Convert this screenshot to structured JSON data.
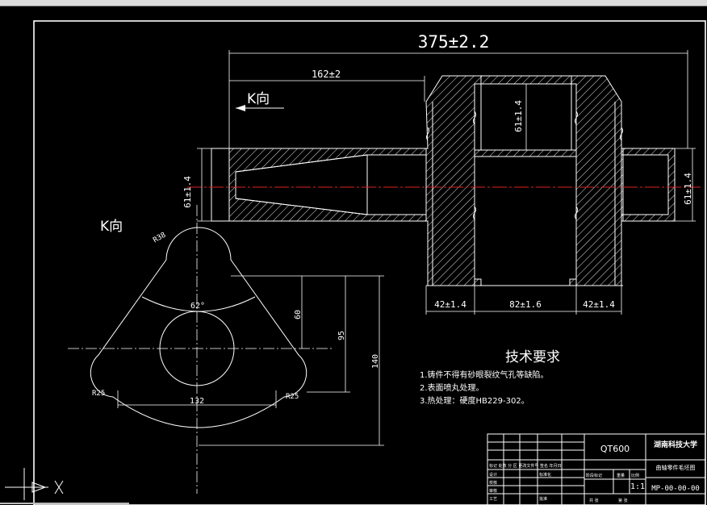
{
  "drawing": {
    "view_label_top": "K向",
    "view_label_side": "K向",
    "dims": {
      "overall_length": "375±2.2",
      "left_length": "162±2",
      "dia_left": "61±1.4",
      "dia_center": "61±1.4",
      "dia_right": "61±1.4",
      "seg1": "42±1.4",
      "seg2": "82±1.6",
      "seg3": "42±1.4",
      "r_top": "R38",
      "angle": "62°",
      "h60": "60",
      "h95": "95",
      "h140": "140",
      "w132": "132",
      "r25_left": "R25",
      "r25_right": "R25"
    },
    "tech_req": {
      "title": "技术要求",
      "item1": "1.铸件不得有砂眼裂纹气孔等缺陷。",
      "item2": "2.表面喷丸处理。",
      "item3": "3.热处理：硬度HB229-302。"
    },
    "title_block": {
      "material": "QT600",
      "school": "湖南科技大学",
      "part_name": "曲轴零件毛坯图",
      "scale": "1:1",
      "drawing_no": "MP-00-00-00",
      "r1": "标记 处数 分 区 更改文件号 签名 年月日",
      "c_design": "设计",
      "c_std": "标准化",
      "c_check": "审核",
      "c_craft": "工艺",
      "c_approve": "批准",
      "c_review": "校核",
      "c_stage": "阶段标记",
      "c_weight": "重量",
      "c_ratio": "比例",
      "c_total": "共 张",
      "c_page": "第 张"
    }
  }
}
